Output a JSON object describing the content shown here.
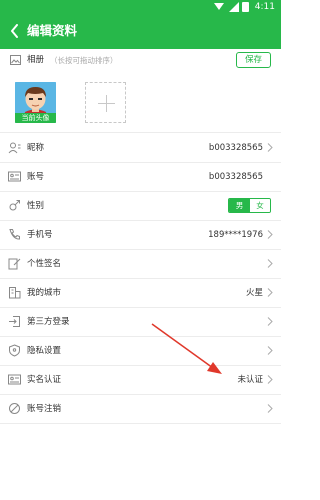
{
  "status_bar": {
    "time": "4:11"
  },
  "header": {
    "title": "编辑资料",
    "back_icon": "chevron-left-icon"
  },
  "album": {
    "label": "相册",
    "hint": "（长按可拖动排序）",
    "save_label": "保存"
  },
  "avatar": {
    "caption": "当前头像"
  },
  "rows": [
    {
      "id": "nickname",
      "icon": "user-card-icon",
      "label": "昵称",
      "value": "b003328565",
      "chevron": true
    },
    {
      "id": "account",
      "icon": "id-card-icon",
      "label": "账号",
      "value": "b003328565",
      "chevron": false
    },
    {
      "id": "gender",
      "icon": "gender-icon",
      "label": "性别",
      "value": "",
      "chevron": false
    },
    {
      "id": "phone",
      "icon": "phone-icon",
      "label": "手机号",
      "value": "189****1976",
      "chevron": true
    },
    {
      "id": "signature",
      "icon": "edit-icon",
      "label": "个性签名",
      "value": "",
      "chevron": true
    },
    {
      "id": "city",
      "icon": "building-icon",
      "label": "我的城市",
      "value": "火星",
      "chevron": true
    },
    {
      "id": "third-party",
      "icon": "login-icon",
      "label": "第三方登录",
      "value": "",
      "chevron": true
    },
    {
      "id": "privacy",
      "icon": "shield-icon",
      "label": "隐私设置",
      "value": "",
      "chevron": true
    },
    {
      "id": "verification",
      "icon": "id-card-icon",
      "label": "实名认证",
      "value": "未认证",
      "chevron": true
    },
    {
      "id": "deactivate",
      "icon": "ban-icon",
      "label": "账号注销",
      "value": "",
      "chevron": true
    }
  ],
  "gender": {
    "male": "男",
    "female": "女",
    "selected": "男"
  },
  "colors": {
    "brand": "#27b84a",
    "annotation_arrow": "#e0382b"
  }
}
